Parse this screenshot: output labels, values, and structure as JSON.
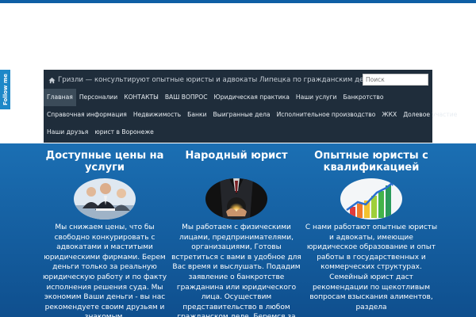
{
  "header": {
    "site_title": "Гризли — консультируют опытные юристы и адвокаты Липецка по гражданским делам",
    "search_placeholder": "Поиск",
    "follow_tab": "Follow me"
  },
  "nav": {
    "rows": [
      [
        "Главная",
        "Персоналии",
        "КОНТАКТЫ",
        "ВАШ ВОПРОС",
        "Юридическая практика",
        "Наши услуги",
        "Банкротство"
      ],
      [
        "Справочная информация",
        "Недвижимость",
        "Банки",
        "Выигранные дела",
        "Исполнительное производство",
        "ЖКХ",
        "Долевое участие"
      ],
      [
        "Наши друзья",
        "юрист в Воронеже"
      ]
    ],
    "active": "Главная"
  },
  "columns": [
    {
      "title": "Доступные цены на услуги",
      "icon": "business-meeting-photo",
      "text": "Мы снижаем цены, что бы свободно конкурировать с адвокатами и маститыми юридическими фирмами. Берем деньги только за реальную юридическую работу и по факту исполнения решения суда. Мы экономим Ваши деньги - вы нас рекомендуете своим друзьям и знакомым."
    },
    {
      "title": "Народный юрист",
      "icon": "lawyer-hands-light-photo",
      "text": "Мы работаем с физическими лицами, предпринимателями, организациями, Готовы встретиться с вами в удобное для Вас время и выслушать. Подадим заявление о банкротстве гражданина или юридического лица. Осуществим представительство в любом гражданском деле. Беремся за"
    },
    {
      "title": "Опытные юристы с квалификацией",
      "icon": "growth-chart-photo",
      "text": "С нами работают опытные юристы и адвокаты, имеющие юридическое образование и опыт работы в государственных и коммерческих структурах. Семейный юрист даст рекомендации по щекотливым вопросам взыскания алиментов, раздела"
    }
  ]
}
